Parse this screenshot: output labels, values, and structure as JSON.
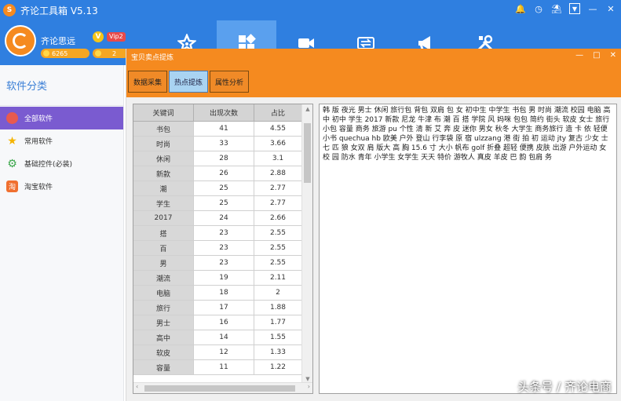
{
  "app": {
    "title": "齐论工具箱 V5.13",
    "logo_char": "S"
  },
  "titlebar_icons": [
    "bell-icon",
    "clock-icon",
    "shirt-icon",
    "dropdown-icon",
    "minimize-icon",
    "close-icon"
  ],
  "user": {
    "name": "齐论思远",
    "vip_badge": "V",
    "vip_label": "Vip2",
    "coins": "6265",
    "points": "2"
  },
  "topnav": [
    {
      "name": "home-tab",
      "icon": "star-icon",
      "active": false
    },
    {
      "name": "apps-tab",
      "icon": "grid-icon",
      "active": true
    },
    {
      "name": "video-tab",
      "icon": "camera-icon",
      "active": false
    },
    {
      "name": "transfer-tab",
      "icon": "transfer-icon",
      "active": false
    },
    {
      "name": "broadcast-tab",
      "icon": "megaphone-icon",
      "active": false
    },
    {
      "name": "tools-tab",
      "icon": "tools-icon",
      "active": false
    }
  ],
  "sidebar": {
    "heading": "软件分类",
    "items": [
      {
        "label": "全部软件",
        "icon": "pie-icon",
        "color": "#e85a4f",
        "active": true
      },
      {
        "label": "常用软件",
        "icon": "star-icon",
        "color": "#f5b400",
        "active": false
      },
      {
        "label": "基础控件(必装)",
        "icon": "gear-icon",
        "color": "#3aa64a",
        "active": false
      },
      {
        "label": "淘宝软件",
        "icon": "taobao-icon",
        "color": "#f07030",
        "active": false
      }
    ]
  },
  "dialog": {
    "title": "宝贝卖点提炼",
    "tabs": [
      {
        "label": "数据采集",
        "active": false
      },
      {
        "label": "热点提炼",
        "active": true
      },
      {
        "label": "属性分析",
        "active": false
      }
    ],
    "table": {
      "headers": [
        "关键词",
        "出现次数",
        "占比"
      ],
      "rows": [
        [
          "书包",
          "41",
          "4.55"
        ],
        [
          "时尚",
          "33",
          "3.66"
        ],
        [
          "休闲",
          "28",
          "3.1"
        ],
        [
          "新款",
          "26",
          "2.88"
        ],
        [
          "潮",
          "25",
          "2.77"
        ],
        [
          "学生",
          "25",
          "2.77"
        ],
        [
          "2017",
          "24",
          "2.66"
        ],
        [
          "搭",
          "23",
          "2.55"
        ],
        [
          "百",
          "23",
          "2.55"
        ],
        [
          "男",
          "23",
          "2.55"
        ],
        [
          "潮流",
          "19",
          "2.11"
        ],
        [
          "电脑",
          "18",
          "2"
        ],
        [
          "旅行",
          "17",
          "1.88"
        ],
        [
          "男士",
          "16",
          "1.77"
        ],
        [
          "高中",
          "14",
          "1.55"
        ],
        [
          "软皮",
          "12",
          "1.33"
        ],
        [
          "容量",
          "11",
          "1.22"
        ]
      ]
    },
    "keywords_text": "韩 版 夜光 男士 休闲 旅行包 背包 双肩 包 女 初中生 中学生 书包 男 时尚 潮流 校园 电脑 高中 初中 学生 2017 新款 尼龙 牛津 布 潮 百 搭 学院 风 妈咪 包包 简约 街头 软皮 女士 旅行 小包 容量 商务 旅游 pu 个性 清 新 艾 奔 皮 迷你 男女 秋冬 大学生 商务旅行 造 卡 依 轻便 小书 quechua hb 欧美 户外 登山 行李袋 原 宿 ulzzang 港 街 拍 初 运动 jty 复古 少女 士 七 匹 狼 女双 肩 版大 高 胸 15.6 寸 大小 帆布 golf 折叠 超轻 便携 皮肤 出游 户外运动 女校 园 防水 青年 小学生 女学生 天天 特价 游牧人 真皮 羊皮 巴 韵 包肩 务"
  },
  "watermark": "头条号 / 齐论电商",
  "colors": {
    "blue": "#2f7fe0",
    "orange": "#f58a1f",
    "purple": "#7a5bd0",
    "tab_active": "#a9d3f2"
  }
}
